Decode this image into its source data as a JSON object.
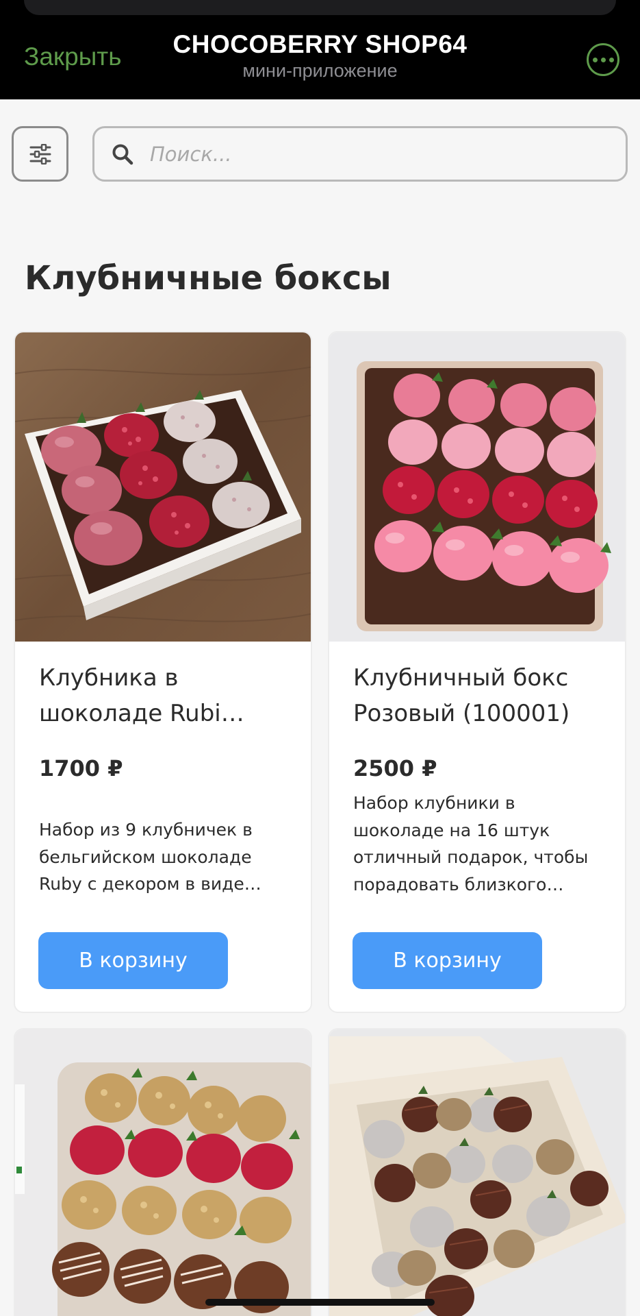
{
  "header": {
    "close_label": "Закрыть",
    "title": "CHOCOBERRY SHOP64",
    "subtitle": "мини-приложение",
    "more_icon": "more-dots-icon",
    "accent_color": "#5e9b4b"
  },
  "search": {
    "placeholder": "Поиск...",
    "value": "",
    "filter_icon": "filter-sliders-icon",
    "search_icon": "search-icon"
  },
  "section": {
    "title": "Клубничные боксы"
  },
  "products": [
    {
      "name": "Клубника в шоколаде Rubi…",
      "price": "1700 ₽",
      "description": "Набор из 9 клубничек в бельгийском шоколаде Ruby с декором в виде…",
      "button_label": "В корзину"
    },
    {
      "name": "Клубничный бокс Розовый (100001)",
      "price": "2500 ₽",
      "description": "Набор клубники в шоколаде на 16 штук отличный подарок, чтобы порадовать близкого…",
      "button_label": "В корзину"
    }
  ],
  "colors": {
    "button": "#4a9bf8",
    "background": "#f6f6f6"
  }
}
